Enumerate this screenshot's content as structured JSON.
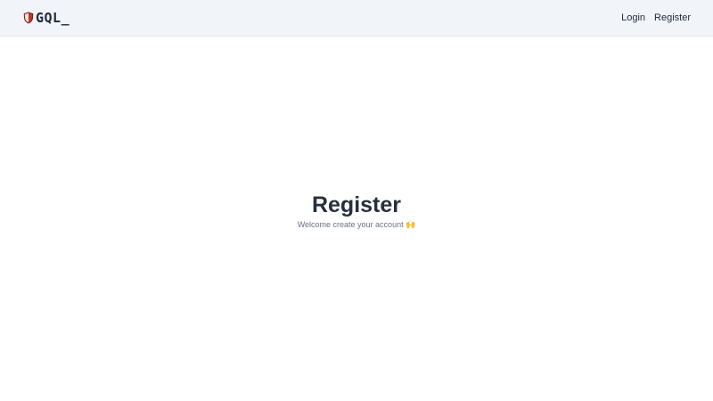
{
  "navbar": {
    "brand": {
      "icon": "shield-icon",
      "text": "GQL_"
    },
    "links": {
      "login": "Login",
      "register": "Register"
    }
  },
  "main": {
    "title": "Register",
    "subtitle": "Welcome create your account 🙌"
  },
  "colors": {
    "navbar_bg": "#f1f4f9",
    "shield_red": "#c0392b",
    "shield_dark": "#7f1d1d",
    "text_dark": "#1f2937",
    "text_muted": "#6b7280"
  }
}
